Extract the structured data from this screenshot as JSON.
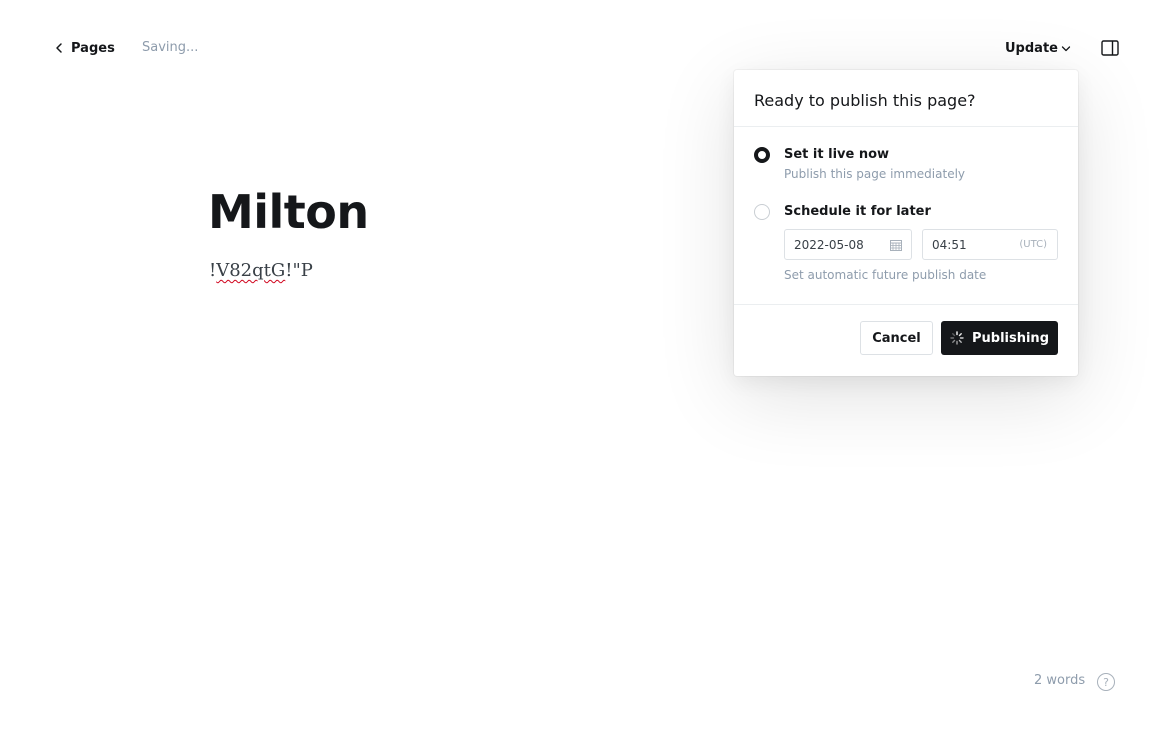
{
  "header": {
    "back_label": "Pages",
    "status": "Saving...",
    "update_label": "Update"
  },
  "editor": {
    "title": "Milton",
    "body_misspelled": "V82qtG",
    "body_prefix": "!",
    "body_suffix": "!\"P"
  },
  "publish_menu": {
    "title": "Ready to publish this page?",
    "options": [
      {
        "label": "Set it live now",
        "description": "Publish this page immediately",
        "selected": true
      },
      {
        "label": "Schedule it for later",
        "description": "Set automatic future publish date",
        "selected": false
      }
    ],
    "date_value": "2022-05-08",
    "time_value": "04:51",
    "timezone": "(UTC)",
    "cancel_label": "Cancel",
    "publish_label": "Publishing"
  },
  "footer": {
    "word_count": "2 words",
    "help_label": "?"
  },
  "icons": {
    "back": "chevron-left-icon",
    "dropdown": "chevron-down-icon",
    "sidebar": "sidebar-toggle-icon",
    "calendar": "calendar-icon",
    "loading": "spinner-icon",
    "help": "question-circle-icon"
  },
  "colors": {
    "primary_text": "#15171a",
    "muted_text": "#8e9cac",
    "button_dark": "#15171a",
    "border": "#dde1e5",
    "spellcheck": "#d0021b"
  }
}
